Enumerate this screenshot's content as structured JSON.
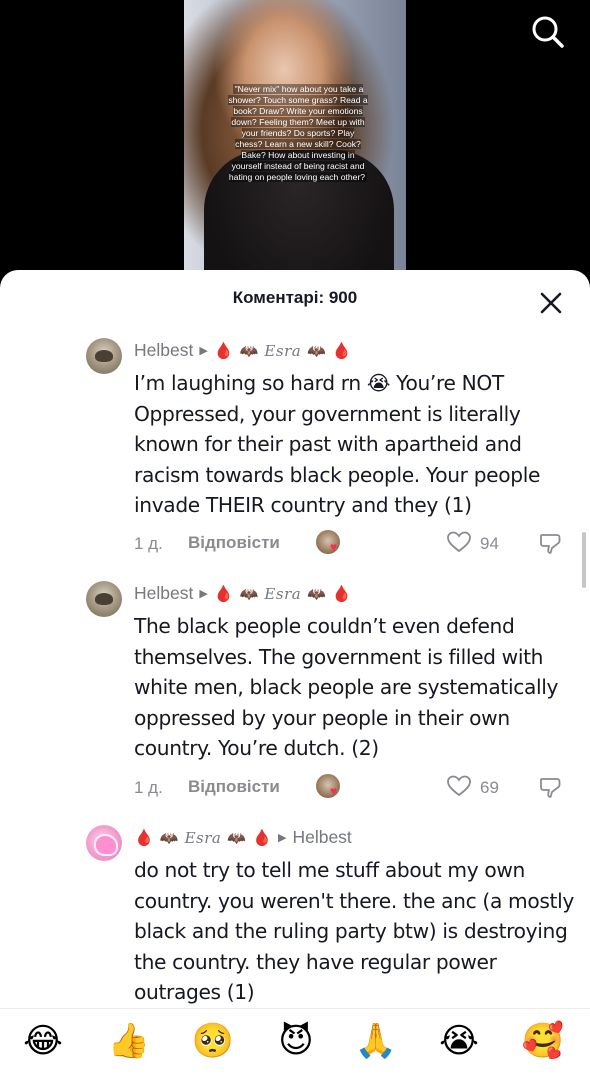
{
  "video": {
    "caption": "\"Never mix\" how about you take a shower? Touch some grass? Read a book? Draw? Write your emotions down? Feeling them? Meet up with your friends? Do sports? Play chess? Learn a new skill? Cook? Bake? How about investing in yourself instead of being racist and hating on people loving each other?"
  },
  "header": {
    "search_icon": "search-icon"
  },
  "comments_sheet": {
    "title": "Коментарі: 900",
    "close_icon": "close-icon",
    "comments": [
      {
        "author": "Helbest",
        "reply_to": "Esra",
        "text": "I’m laughing so hard rn 😭 You’re NOT Oppressed, your government is literally known for their past with apartheid and racism towards black people. Your people invade THEIR country and they (1)",
        "time": "1 д.",
        "reply_label": "Відповісти",
        "likes": "94"
      },
      {
        "author": "Helbest",
        "reply_to": "Esra",
        "text": "The black people couldn’t even defend themselves. The government is filled with white men, black people are systematically oppressed by your people in their own country. You’re dutch. (2)",
        "time": "1 д.",
        "reply_label": "Відповісти",
        "likes": "69"
      },
      {
        "author": "Esra",
        "reply_to": "Helbest",
        "text": "do not try to tell me stuff about my own country. you weren't there. the anc (a mostly black and the ruling party btw) is destroying the country. they have regular power outrages (1)"
      }
    ]
  },
  "emoji_bar": [
    "😂",
    "👍",
    "🥺",
    "😈",
    "🙏",
    "😭",
    "🥰"
  ],
  "colors": {
    "accent_red": "#fe2c55",
    "text_primary": "#161823",
    "text_secondary": "#757781"
  }
}
